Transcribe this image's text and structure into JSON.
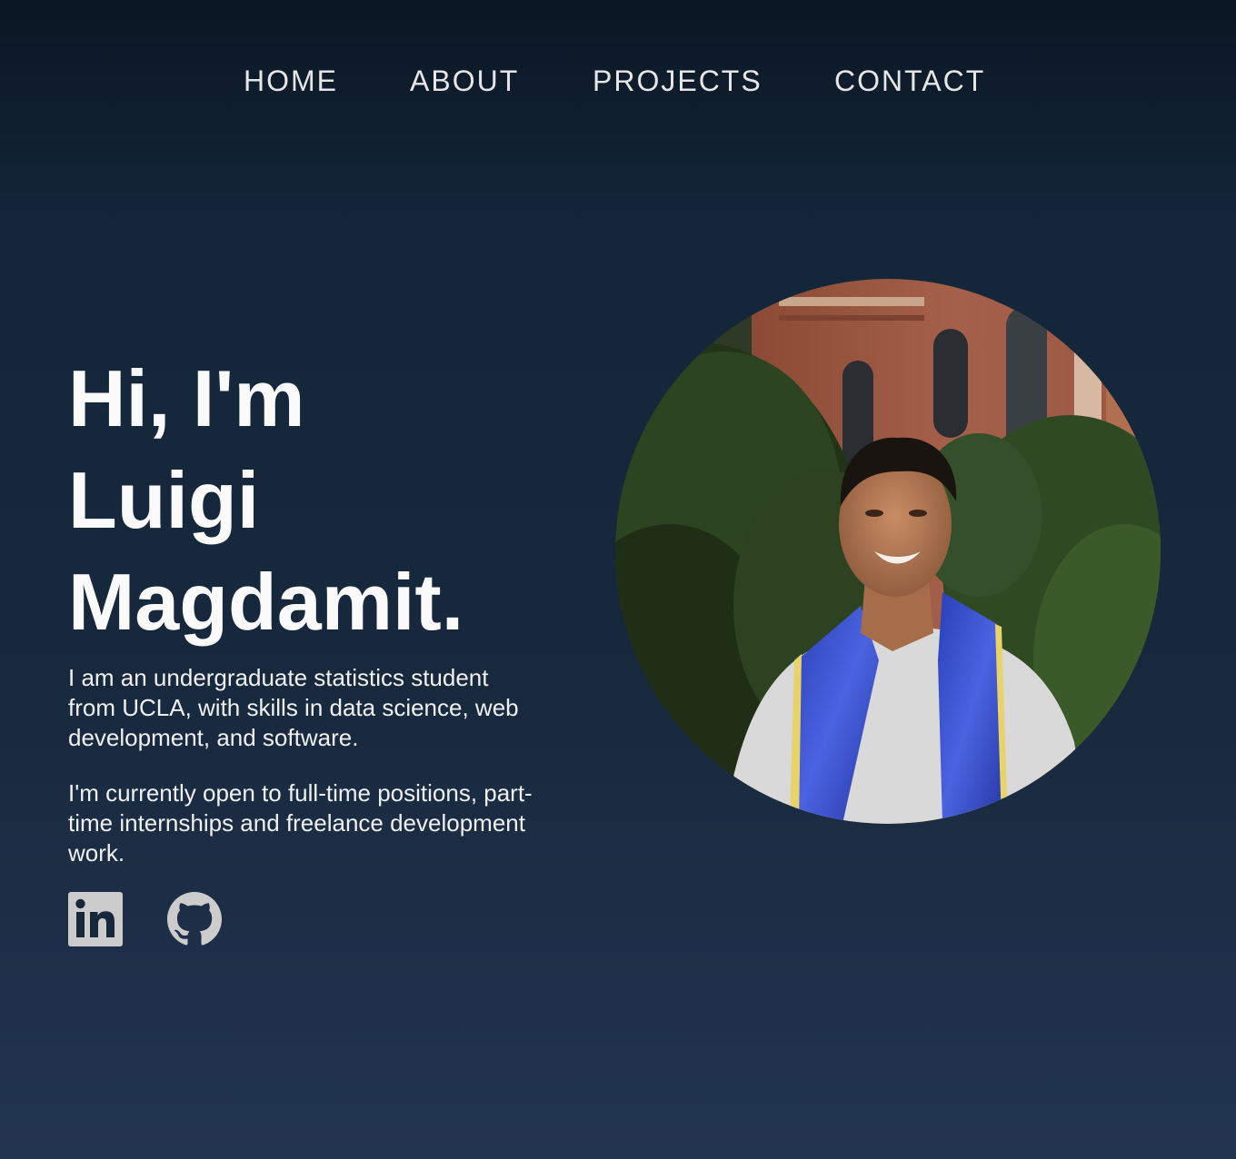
{
  "nav": {
    "items": [
      {
        "label": "HOME"
      },
      {
        "label": "ABOUT"
      },
      {
        "label": "PROJECTS"
      },
      {
        "label": "CONTACT"
      }
    ]
  },
  "hero": {
    "title_lines": [
      "Hi, I'm",
      "Luigi",
      "Magdamit."
    ],
    "paragraphs": [
      "I am an undergraduate statistics student from UCLA, with skills in data science, web development, and software.",
      "I'm currently open to full-time positions, part-time internships and freelance development work."
    ],
    "socials": [
      {
        "icon": "linkedin-icon"
      },
      {
        "icon": "github-icon"
      }
    ]
  },
  "portrait": {
    "description_icon": "portrait-photo"
  },
  "colors": {
    "bg_top": "#0b1623",
    "bg_bottom": "#22354f",
    "text": "#f5f5f5",
    "icon": "#cccccc"
  }
}
